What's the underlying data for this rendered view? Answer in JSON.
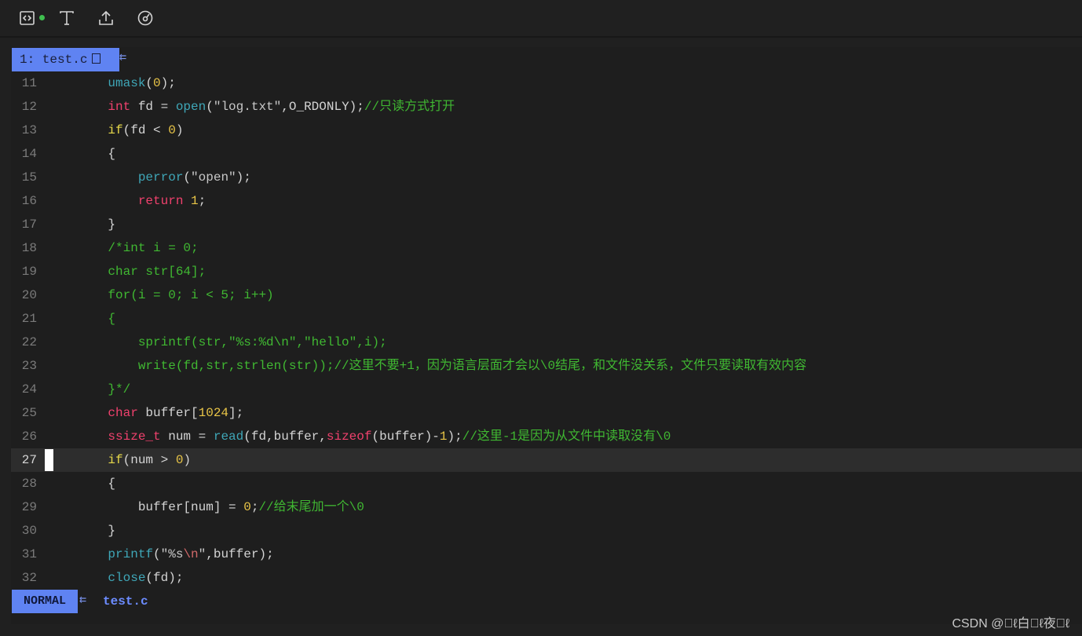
{
  "toolbar": {
    "icons": [
      "code-view-icon",
      "text-format-icon",
      "upload-icon",
      "compass-icon"
    ],
    "status_dot_color": "#3fbf4f"
  },
  "tab": {
    "label": "1: test.c",
    "arrow": "⇇"
  },
  "colors": {
    "keyword": "#f0416d",
    "keyword_yellow": "#e6d84a",
    "function": "#3fa7b8",
    "string": "#c8c8c8",
    "escape": "#d16969",
    "number": "#e8c447",
    "comment": "#40b832",
    "text": "#d4d4d4",
    "accent": "#5f83f2"
  },
  "editor": {
    "current_line": "27",
    "lines": [
      {
        "num": "11",
        "segments": [
          {
            "t": "    ",
            "c": "text"
          },
          {
            "t": "umask",
            "c": "function"
          },
          {
            "t": "(",
            "c": "text"
          },
          {
            "t": "0",
            "c": "number"
          },
          {
            "t": ");",
            "c": "text"
          }
        ]
      },
      {
        "num": "12",
        "segments": [
          {
            "t": "    ",
            "c": "text"
          },
          {
            "t": "int",
            "c": "keyword"
          },
          {
            "t": " fd = ",
            "c": "text"
          },
          {
            "t": "open",
            "c": "function"
          },
          {
            "t": "(",
            "c": "text"
          },
          {
            "t": "\"log.txt\"",
            "c": "string"
          },
          {
            "t": ",O_RDONLY);",
            "c": "text"
          },
          {
            "t": "//只读方式打开",
            "c": "comment"
          }
        ]
      },
      {
        "num": "13",
        "segments": [
          {
            "t": "    ",
            "c": "text"
          },
          {
            "t": "if",
            "c": "keyword_yellow"
          },
          {
            "t": "(fd < ",
            "c": "text"
          },
          {
            "t": "0",
            "c": "number"
          },
          {
            "t": ")",
            "c": "text"
          }
        ]
      },
      {
        "num": "14",
        "segments": [
          {
            "t": "    {",
            "c": "text"
          }
        ]
      },
      {
        "num": "15",
        "segments": [
          {
            "t": "        ",
            "c": "text"
          },
          {
            "t": "perror",
            "c": "function"
          },
          {
            "t": "(",
            "c": "text"
          },
          {
            "t": "\"open\"",
            "c": "string"
          },
          {
            "t": ");",
            "c": "text"
          }
        ]
      },
      {
        "num": "16",
        "segments": [
          {
            "t": "        ",
            "c": "text"
          },
          {
            "t": "return",
            "c": "keyword"
          },
          {
            "t": " ",
            "c": "text"
          },
          {
            "t": "1",
            "c": "number"
          },
          {
            "t": ";",
            "c": "text"
          }
        ]
      },
      {
        "num": "17",
        "segments": [
          {
            "t": "    }",
            "c": "text"
          }
        ]
      },
      {
        "num": "18",
        "segments": [
          {
            "t": "    /*int i = 0;",
            "c": "comment"
          }
        ]
      },
      {
        "num": "19",
        "segments": [
          {
            "t": "    char str[64];",
            "c": "comment"
          }
        ]
      },
      {
        "num": "20",
        "segments": [
          {
            "t": "    for(i = 0; i < 5; i++)",
            "c": "comment"
          }
        ]
      },
      {
        "num": "21",
        "segments": [
          {
            "t": "    {",
            "c": "comment"
          }
        ]
      },
      {
        "num": "22",
        "segments": [
          {
            "t": "        sprintf(str,\"%s:%d\\n\",\"hello\",i);",
            "c": "comment"
          }
        ]
      },
      {
        "num": "23",
        "segments": [
          {
            "t": "        write(fd,str,strlen(str));//这里不要+1，因为语言层面才会以\\0结尾，和文件没关系，文件只要读取有效内容",
            "c": "comment"
          }
        ]
      },
      {
        "num": "24",
        "segments": [
          {
            "t": "    }*/",
            "c": "comment"
          }
        ]
      },
      {
        "num": "25",
        "segments": [
          {
            "t": "    ",
            "c": "text"
          },
          {
            "t": "char",
            "c": "keyword"
          },
          {
            "t": " buffer[",
            "c": "text"
          },
          {
            "t": "1024",
            "c": "number"
          },
          {
            "t": "];",
            "c": "text"
          }
        ]
      },
      {
        "num": "26",
        "segments": [
          {
            "t": "    ",
            "c": "text"
          },
          {
            "t": "ssize_t",
            "c": "keyword"
          },
          {
            "t": " num = ",
            "c": "text"
          },
          {
            "t": "read",
            "c": "function"
          },
          {
            "t": "(fd,buffer,",
            "c": "text"
          },
          {
            "t": "sizeof",
            "c": "keyword"
          },
          {
            "t": "(buffer)-",
            "c": "text"
          },
          {
            "t": "1",
            "c": "number"
          },
          {
            "t": ");",
            "c": "text"
          },
          {
            "t": "//这里-1是因为从文件中读取没有\\0",
            "c": "comment"
          }
        ]
      },
      {
        "num": "27",
        "segments": [
          {
            "t": "    ",
            "c": "text"
          },
          {
            "t": "if",
            "c": "keyword_yellow"
          },
          {
            "t": "(num > ",
            "c": "text"
          },
          {
            "t": "0",
            "c": "number"
          },
          {
            "t": ")",
            "c": "text"
          }
        ]
      },
      {
        "num": "28",
        "segments": [
          {
            "t": "    {",
            "c": "text"
          }
        ]
      },
      {
        "num": "29",
        "segments": [
          {
            "t": "        buffer[num] = ",
            "c": "text"
          },
          {
            "t": "0",
            "c": "number"
          },
          {
            "t": ";",
            "c": "text"
          },
          {
            "t": "//给末尾加一个\\0",
            "c": "comment"
          }
        ]
      },
      {
        "num": "30",
        "segments": [
          {
            "t": "    }",
            "c": "text"
          }
        ]
      },
      {
        "num": "31",
        "segments": [
          {
            "t": "    ",
            "c": "text"
          },
          {
            "t": "printf",
            "c": "function"
          },
          {
            "t": "(",
            "c": "text"
          },
          {
            "t": "\"%s",
            "c": "string"
          },
          {
            "t": "\\n",
            "c": "escape"
          },
          {
            "t": "\"",
            "c": "string"
          },
          {
            "t": ",buffer);",
            "c": "text"
          }
        ]
      },
      {
        "num": "32",
        "segments": [
          {
            "t": "    ",
            "c": "text"
          },
          {
            "t": "close",
            "c": "function"
          },
          {
            "t": "(fd);",
            "c": "text"
          }
        ]
      }
    ]
  },
  "statusbar": {
    "mode": "NORMAL",
    "arrow": "⇇",
    "filename": "test.c"
  },
  "watermark": "CSDN @\u0000ℓ白\u0000ℓ夜\u0000ℓ"
}
